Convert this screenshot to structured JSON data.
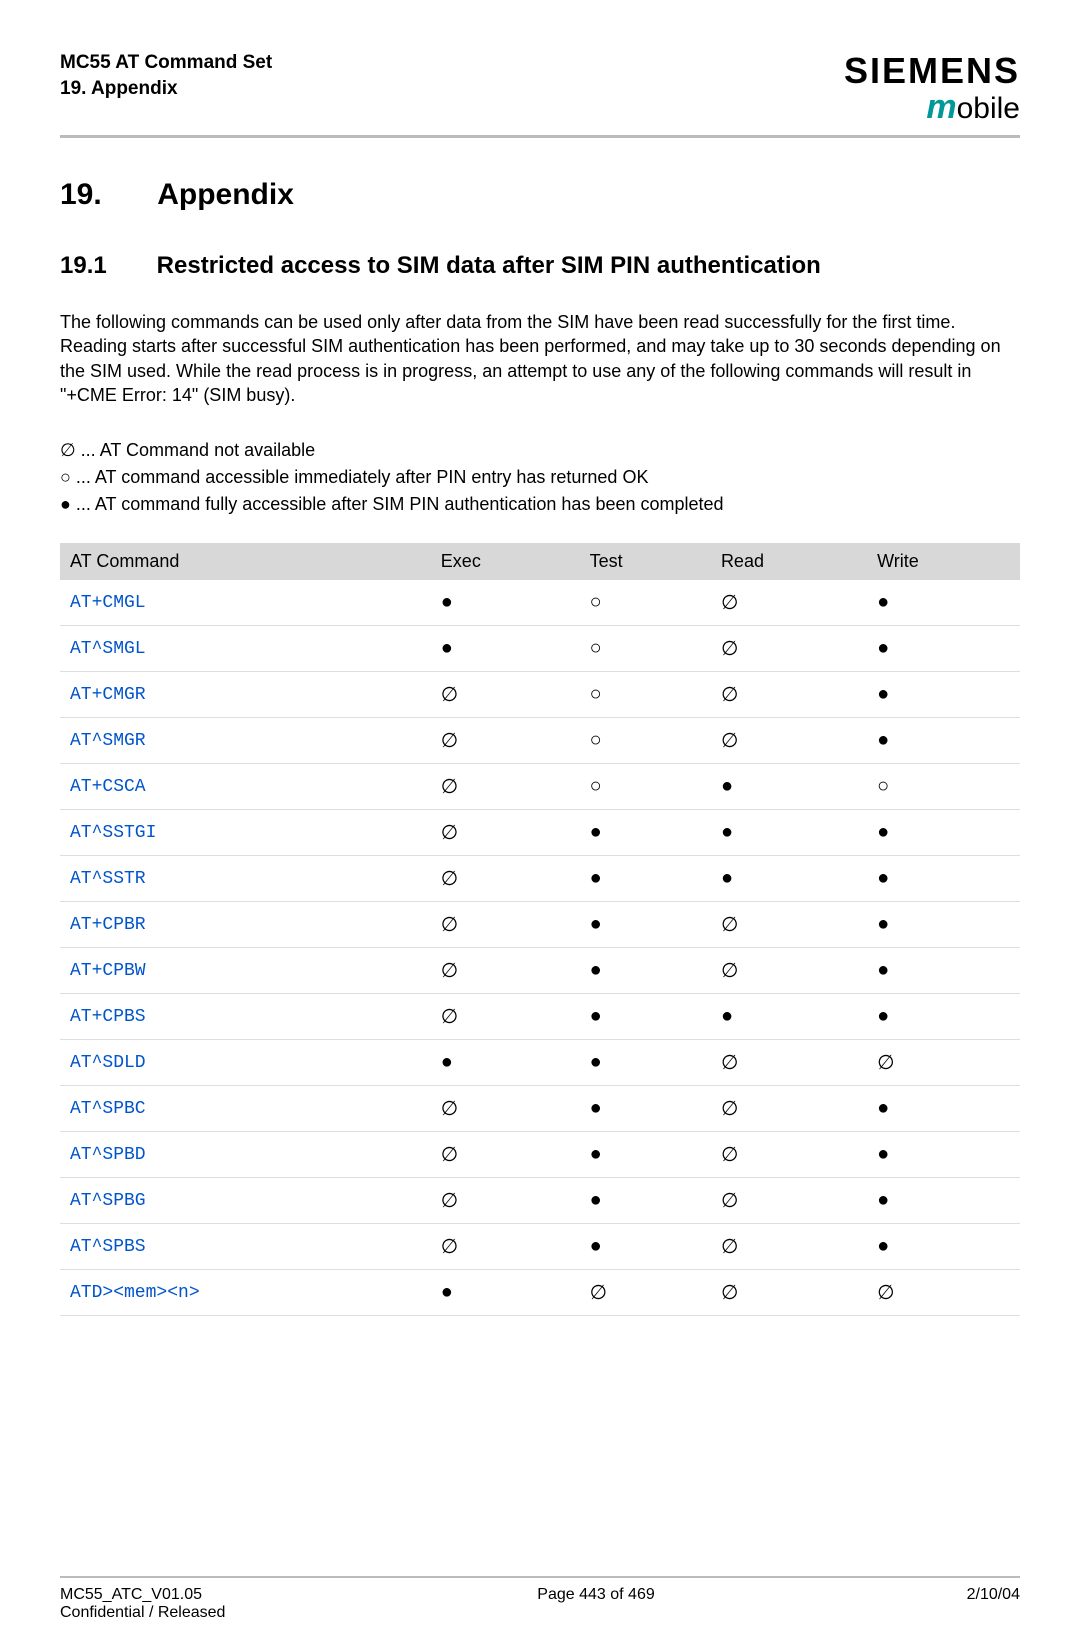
{
  "header": {
    "doc_title": "MC55 AT Command Set",
    "section_label": "19. Appendix",
    "brand": "SIEMENS",
    "subbrand_m": "m",
    "subbrand_rest": "obile"
  },
  "h1": {
    "num": "19.",
    "title": "Appendix"
  },
  "h2": {
    "num": "19.1",
    "title": "Restricted access to SIM data after SIM PIN authentication"
  },
  "para": "The following commands can be used only after data from the SIM have been read successfully for the first time. Reading starts after successful SIM authentication has been performed, and may take up to 30 seconds depending on the SIM used. While the read process is in progress, an attempt to use any of the following commands will result in \"+CME Error: 14\" (SIM busy).",
  "legend": {
    "l1": "∅ ... AT Command not available",
    "l2": "○ ... AT command accessible immediately after PIN entry has returned OK",
    "l3": "● ... AT command fully accessible after SIM PIN authentication has been completed"
  },
  "table": {
    "headers": [
      "AT Command",
      "Exec",
      "Test",
      "Read",
      "Write"
    ],
    "rows": [
      {
        "cmd": "AT+CMGL",
        "exec": "●",
        "test": "○",
        "read": "∅",
        "write": "●"
      },
      {
        "cmd": "AT^SMGL",
        "exec": "●",
        "test": "○",
        "read": "∅",
        "write": "●"
      },
      {
        "cmd": "AT+CMGR",
        "exec": "∅",
        "test": "○",
        "read": "∅",
        "write": "●"
      },
      {
        "cmd": "AT^SMGR",
        "exec": "∅",
        "test": "○",
        "read": "∅",
        "write": "●"
      },
      {
        "cmd": "AT+CSCA",
        "exec": "∅",
        "test": "○",
        "read": "●",
        "write": "○"
      },
      {
        "cmd": "AT^SSTGI",
        "exec": "∅",
        "test": "●",
        "read": "●",
        "write": "●"
      },
      {
        "cmd": "AT^SSTR",
        "exec": "∅",
        "test": "●",
        "read": "●",
        "write": "●"
      },
      {
        "cmd": "AT+CPBR",
        "exec": "∅",
        "test": "●",
        "read": "∅",
        "write": "●"
      },
      {
        "cmd": "AT+CPBW",
        "exec": "∅",
        "test": "●",
        "read": "∅",
        "write": "●"
      },
      {
        "cmd": "AT+CPBS",
        "exec": "∅",
        "test": "●",
        "read": "●",
        "write": "●"
      },
      {
        "cmd": "AT^SDLD",
        "exec": "●",
        "test": "●",
        "read": "∅",
        "write": "∅"
      },
      {
        "cmd": "AT^SPBC",
        "exec": "∅",
        "test": "●",
        "read": "∅",
        "write": "●"
      },
      {
        "cmd": "AT^SPBD",
        "exec": "∅",
        "test": "●",
        "read": "∅",
        "write": "●"
      },
      {
        "cmd": "AT^SPBG",
        "exec": "∅",
        "test": "●",
        "read": "∅",
        "write": "●"
      },
      {
        "cmd": "AT^SPBS",
        "exec": "∅",
        "test": "●",
        "read": "∅",
        "write": "●"
      },
      {
        "cmd": "ATD><mem><n>",
        "exec": "●",
        "test": "∅",
        "read": "∅",
        "write": "∅"
      }
    ]
  },
  "footer": {
    "left1": "MC55_ATC_V01.05",
    "left2": "Confidential / Released",
    "center": "Page 443 of 469",
    "right": "2/10/04"
  }
}
